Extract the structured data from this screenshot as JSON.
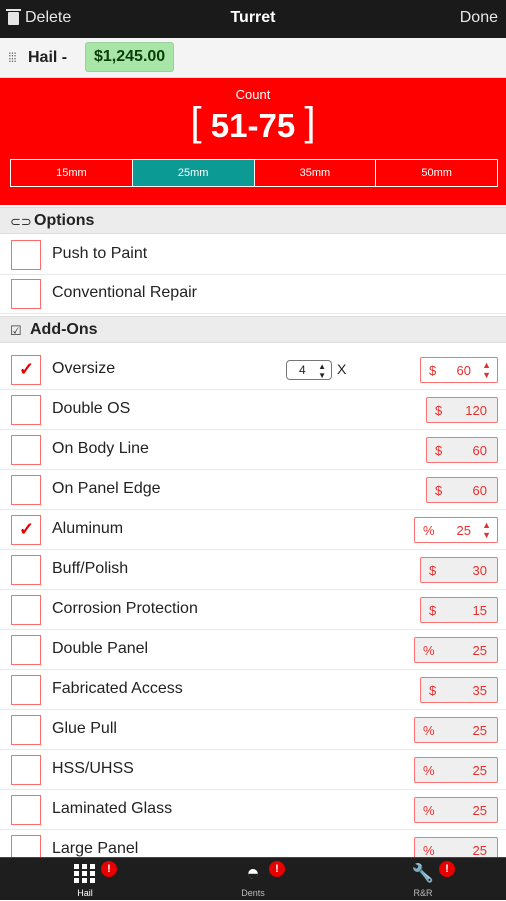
{
  "nav": {
    "delete_label": "Delete",
    "title": "Turret",
    "done_label": "Done"
  },
  "subbar": {
    "label": "Hail -",
    "price": "$1,245.00"
  },
  "count": {
    "label": "Count",
    "value": "51-75"
  },
  "sizes": {
    "items": [
      "15mm",
      "25mm",
      "35mm",
      "50mm"
    ],
    "selected": "25mm"
  },
  "options": {
    "title": "Options",
    "items": [
      {
        "label": "Push to Paint",
        "checked": false
      },
      {
        "label": "Conventional Repair",
        "checked": false
      }
    ]
  },
  "addons": {
    "title": "Add-Ons",
    "oversize_qty": "4",
    "oversize_x": "X",
    "items": [
      {
        "label": "Oversize",
        "checked": true,
        "unit": "$",
        "value": "60",
        "select": true
      },
      {
        "label": "Double OS",
        "checked": false,
        "unit": "$",
        "value": "120",
        "select": false
      },
      {
        "label": "On Body Line",
        "checked": false,
        "unit": "$",
        "value": "60",
        "select": false
      },
      {
        "label": "On Panel Edge",
        "checked": false,
        "unit": "$",
        "value": "60",
        "select": false
      },
      {
        "label": "Aluminum",
        "checked": true,
        "unit": "%",
        "value": "25",
        "select": true
      },
      {
        "label": "Buff/Polish",
        "checked": false,
        "unit": "$",
        "value": "30",
        "select": false
      },
      {
        "label": "Corrosion Protection",
        "checked": false,
        "unit": "$",
        "value": "15",
        "select": false
      },
      {
        "label": "Double Panel",
        "checked": false,
        "unit": "%",
        "value": "25",
        "select": false
      },
      {
        "label": "Fabricated Access",
        "checked": false,
        "unit": "$",
        "value": "35",
        "select": false
      },
      {
        "label": "Glue Pull",
        "checked": false,
        "unit": "%",
        "value": "25",
        "select": false
      },
      {
        "label": "HSS/UHSS",
        "checked": false,
        "unit": "%",
        "value": "25",
        "select": false
      },
      {
        "label": "Laminated Glass",
        "checked": false,
        "unit": "%",
        "value": "25",
        "select": false
      },
      {
        "label": "Large Panel",
        "checked": false,
        "unit": "%",
        "value": "25",
        "select": false
      }
    ]
  },
  "tabs": [
    {
      "label": "Hail",
      "badge": "!",
      "icon": "grid-icon",
      "active": true
    },
    {
      "label": "Dents",
      "badge": "!",
      "icon": "dent-icon",
      "active": false
    },
    {
      "label": "R&R",
      "badge": "!",
      "icon": "wrench-icon",
      "active": false
    }
  ],
  "colors": {
    "accent": "#ff0000",
    "selected_segment": "#0c9b94",
    "price_bg": "#a8e6a8"
  }
}
